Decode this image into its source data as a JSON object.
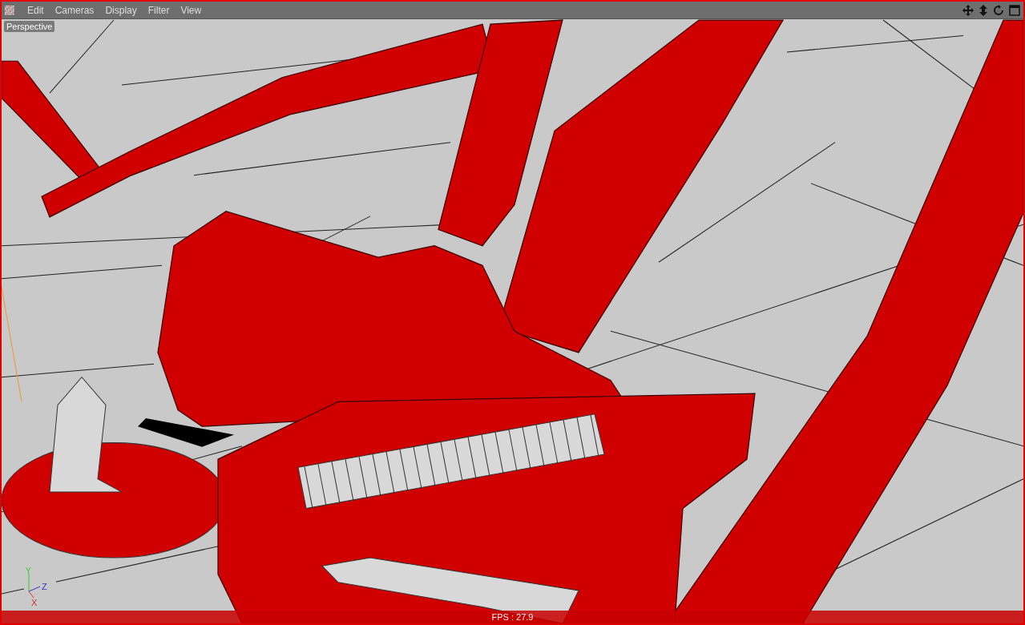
{
  "menu": {
    "items": [
      "Edit",
      "Cameras",
      "Display",
      "Filter",
      "View"
    ]
  },
  "viewport": {
    "camera_label": "Perspective",
    "axes": [
      "Y",
      "Z",
      "X"
    ],
    "fps": "FPS : 27.9"
  }
}
